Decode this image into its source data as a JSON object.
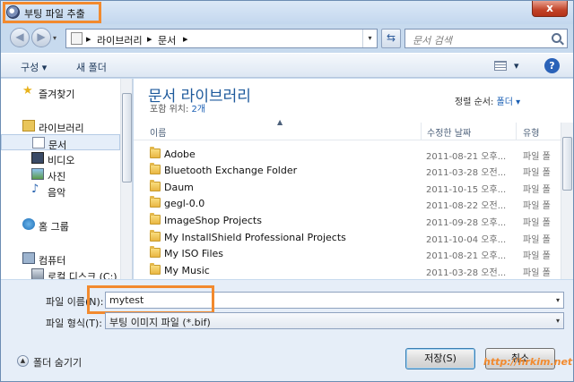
{
  "window": {
    "title": "부팅 파일 추출",
    "close_label": "x"
  },
  "navbar": {
    "back_label": "◀",
    "forward_label": "▶",
    "breadcrumb": [
      "라이브러리",
      "문서"
    ],
    "search_placeholder": "문서 검색"
  },
  "toolbar": {
    "organize": "구성 ▾",
    "new_folder": "새 폴더",
    "view_drop": "▾",
    "help": "?"
  },
  "sidebar": {
    "items": [
      {
        "label": "즐겨찾기",
        "icon": "star-icon"
      },
      {
        "label": "라이브러리",
        "icon": "library-icon"
      },
      {
        "label": "문서",
        "icon": "document-icon",
        "selected": true
      },
      {
        "label": "비디오",
        "icon": "video-icon"
      },
      {
        "label": "사진",
        "icon": "picture-icon"
      },
      {
        "label": "음악",
        "icon": "music-icon"
      },
      {
        "label": "홈 그룹",
        "icon": "homegroup-icon"
      },
      {
        "label": "컴퓨터",
        "icon": "computer-icon"
      },
      {
        "label": "로컬 디스크 (C:)",
        "icon": "disk-icon"
      }
    ]
  },
  "library": {
    "title": "문서 라이브러리",
    "includes_label": "포함 위치:",
    "includes_count": "2개",
    "sort_label": "정렬 순서:",
    "sort_value": "폴더 ▾"
  },
  "columns": {
    "name": "이름",
    "modified": "수정한 날짜",
    "type": "유형"
  },
  "files": [
    {
      "name": "Adobe",
      "date": "2011-08-21 오후...",
      "type": "파일 폴"
    },
    {
      "name": "Bluetooth Exchange Folder",
      "date": "2011-03-28 오전...",
      "type": "파일 폴"
    },
    {
      "name": "Daum",
      "date": "2011-10-15 오후...",
      "type": "파일 폴"
    },
    {
      "name": "gegl-0.0",
      "date": "2011-08-22 오전...",
      "type": "파일 폴"
    },
    {
      "name": "ImageShop Projects",
      "date": "2011-09-28 오후...",
      "type": "파일 폴"
    },
    {
      "name": "My InstallShield Professional Projects",
      "date": "2011-10-04 오후...",
      "type": "파일 폴"
    },
    {
      "name": "My ISO Files",
      "date": "2011-08-21 오후...",
      "type": "파일 폴"
    },
    {
      "name": "My Music",
      "date": "2011-03-28 오전...",
      "type": "파일 폴"
    }
  ],
  "form": {
    "filename_label": "파일 이름(N):",
    "filename_value": "mytest",
    "filetype_label": "파일 형식(T):",
    "filetype_value": "부팅 이미지 파일 (*.bif)"
  },
  "footer": {
    "hide_folders": "폴더 숨기기",
    "save_button": "저장(S)",
    "cancel_button": "취소",
    "watermark": "http://hrkim.net"
  },
  "colors": {
    "highlight": "#f28a2e",
    "library_title": "#1e5a9c",
    "link": "#1a5fb4"
  }
}
